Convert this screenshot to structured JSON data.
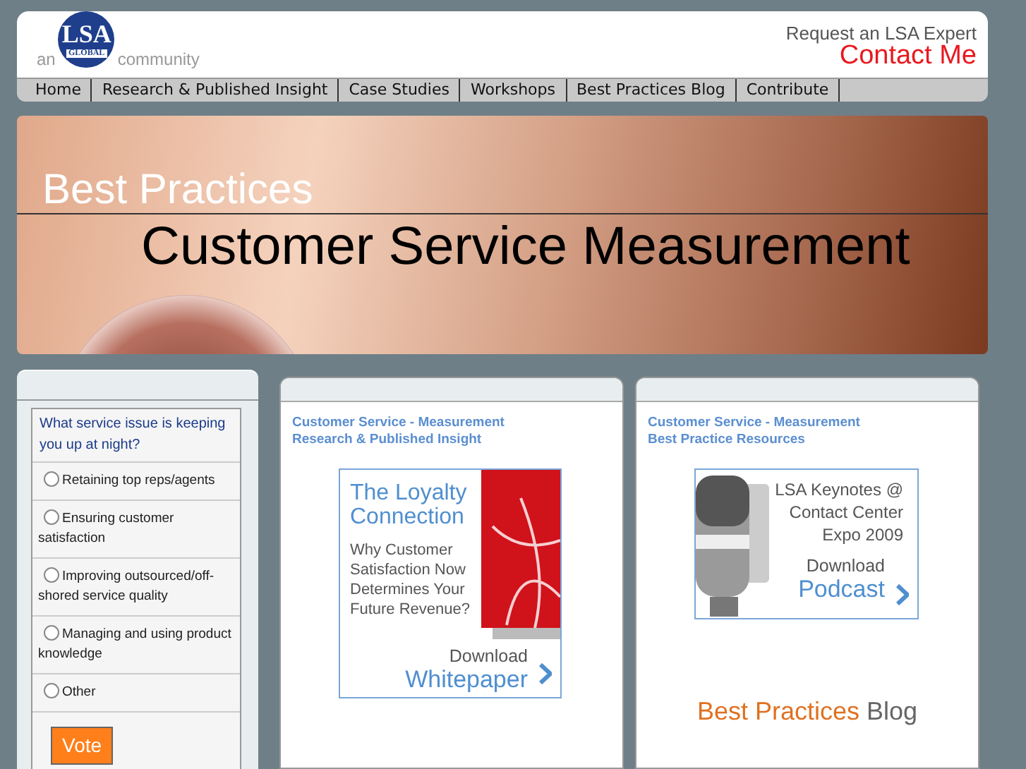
{
  "header": {
    "logo": {
      "prefix": "an",
      "brand": "LSA",
      "sub": "GLOBAL",
      "suffix": "community"
    },
    "request": "Request an LSA Expert",
    "contact": "Contact Me"
  },
  "nav": [
    {
      "label": "Home"
    },
    {
      "label": "Research & Published Insight"
    },
    {
      "label": "Case Studies"
    },
    {
      "label": "Workshops"
    },
    {
      "label": "Best Practices Blog"
    },
    {
      "label": "Contribute"
    }
  ],
  "banner": {
    "kicker": "Best Practices",
    "title": "Customer Service Measurement"
  },
  "poll": {
    "question": "What service issue is keeping you up at night?",
    "options": [
      {
        "label": "Retaining top reps/agents",
        "selected": false
      },
      {
        "label": "Ensuring customer satisfaction",
        "selected": false
      },
      {
        "label": "Improving outsourced/off-shored service quality",
        "selected": false
      },
      {
        "label": "Managing and using product knowledge",
        "selected": false
      },
      {
        "label": "Other",
        "selected": false
      }
    ],
    "button": "Vote"
  },
  "panels": [
    {
      "heading": [
        "Customer Service - Measurement",
        "Research & Published Insight"
      ],
      "promo": {
        "kind": "whitepaper",
        "title": [
          "The Loyalty",
          "Connection"
        ],
        "body": [
          "Why Customer",
          "Satisfaction Now",
          "Determines Your",
          "Future Revenue?"
        ],
        "action": "Download",
        "link": "Whitepaper"
      }
    },
    {
      "heading": [
        "Customer Service - Measurement",
        "Best Practice Resources"
      ],
      "promo": {
        "kind": "podcast",
        "body": [
          "LSA Keynotes @",
          "Contact Center",
          "Expo 2009"
        ],
        "action": "Download",
        "link": "Podcast"
      },
      "blog": {
        "accent": "Best Practices",
        "rest": "Blog"
      }
    }
  ]
}
